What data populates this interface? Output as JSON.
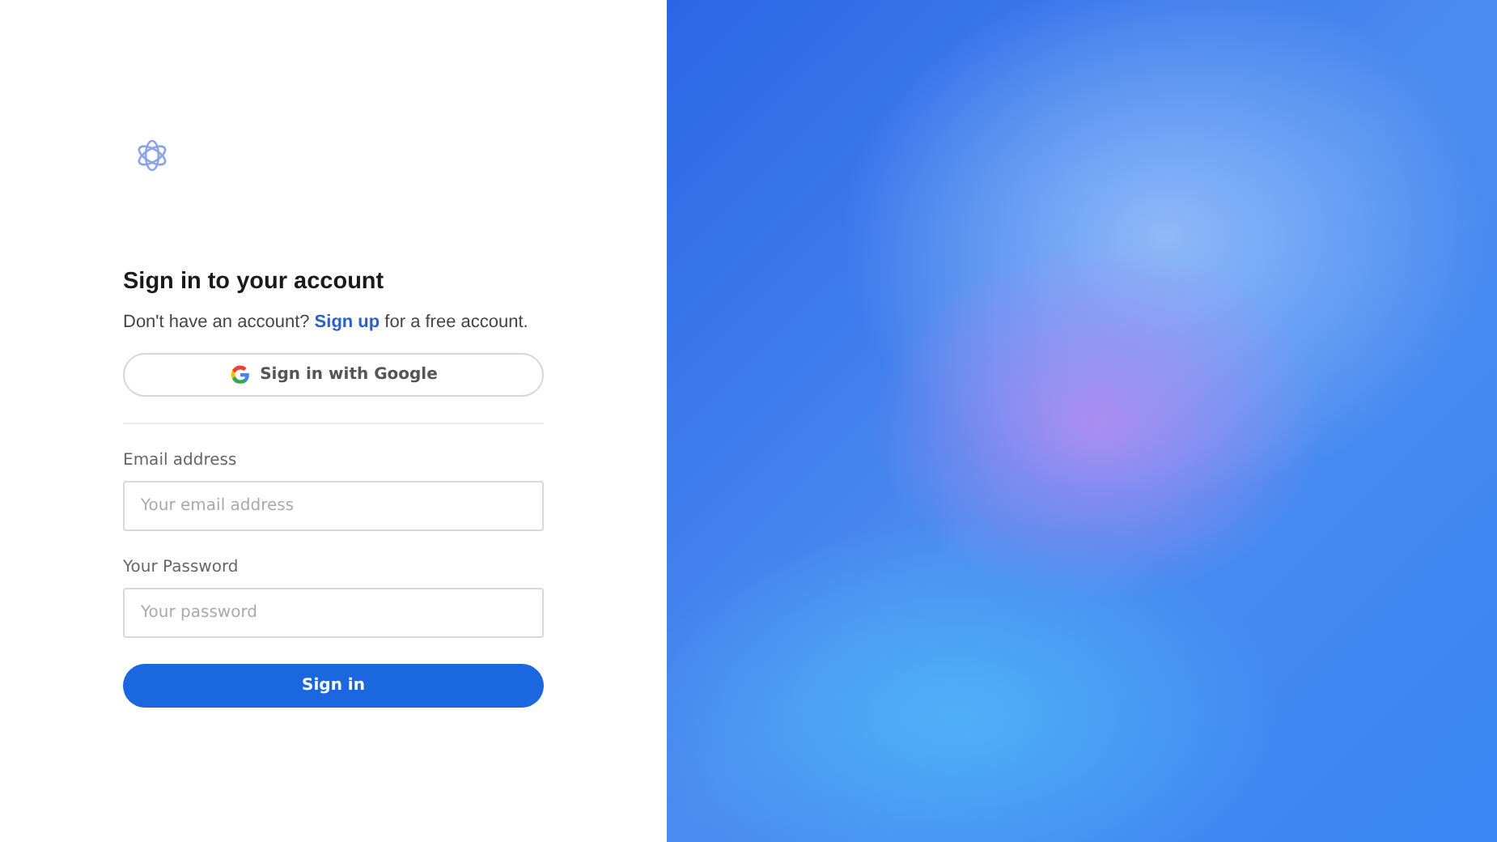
{
  "heading": "Sign in to your account",
  "signup_prompt": {
    "before": "Don't have an account?",
    "link": "Sign up",
    "after": "for a free account."
  },
  "google_button": {
    "label": "Sign in with Google"
  },
  "fields": [
    {
      "label": "Email address",
      "placeholder": "Your email address"
    },
    {
      "label": "Your Password",
      "placeholder": "Your password"
    }
  ],
  "submit_button": {
    "label": "Sign in"
  }
}
